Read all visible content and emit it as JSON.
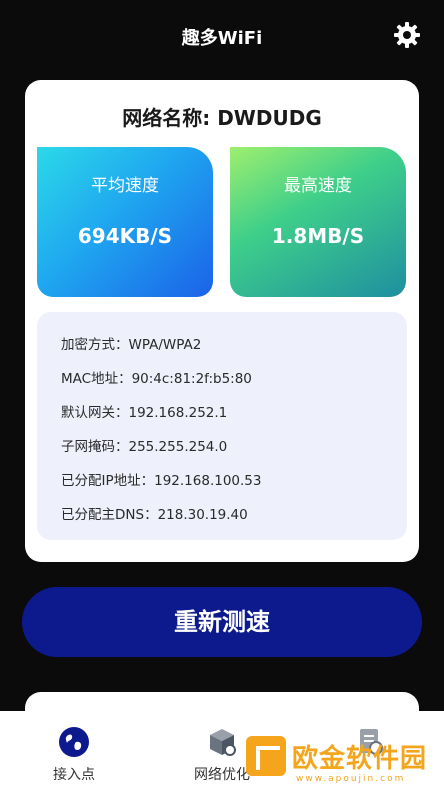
{
  "app": {
    "title": "趣多WiFi"
  },
  "network": {
    "name_label": "网络名称: DWDUDG"
  },
  "speed": {
    "average": {
      "label": "平均速度",
      "value": "694KB/S"
    },
    "max": {
      "label": "最高速度",
      "value": "1.8MB/S"
    }
  },
  "info": [
    "加密方式：WPA/WPA2",
    "MAC地址：90:4c:81:2f:b5:80",
    "默认网关：192.168.252.1",
    "子网掩码：255.255.254.0",
    "已分配IP地址：192.168.100.53",
    "已分配主DNS：218.30.19.40"
  ],
  "actions": {
    "retest_label": "重新测速"
  },
  "nav": [
    {
      "label": "接入点",
      "icon": "globe-icon"
    },
    {
      "label": "网络优化",
      "icon": "cube-icon"
    },
    {
      "label": "",
      "icon": "document-icon"
    }
  ],
  "watermark": {
    "text": "欧金软件园",
    "sub": "www.apoujin.com"
  },
  "colors": {
    "primary": "#0d1a8e",
    "background": "#0b0b0b",
    "accent_orange": "#f4a51c"
  }
}
